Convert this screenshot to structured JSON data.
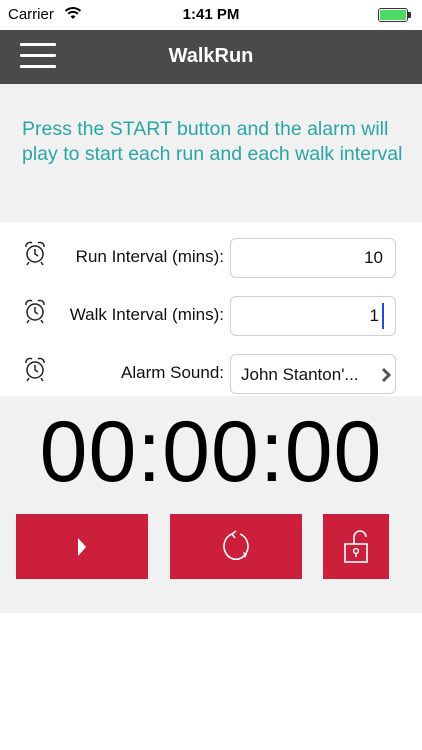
{
  "status_bar": {
    "carrier": "Carrier",
    "time": "1:41 PM",
    "battery_color": "#4cd964"
  },
  "nav": {
    "title": "WalkRun",
    "background": "#4a4a4a",
    "menu_icon": "hamburger-menu-icon"
  },
  "info": {
    "text": "Press the START button and the alarm will play to start each run and each walk interval",
    "color": "#2aa6a6"
  },
  "settings": {
    "run_interval": {
      "label": "Run Interval (mins):",
      "value": "10",
      "icon": "alarm-clock-icon"
    },
    "walk_interval": {
      "label": "Walk Interval (mins):",
      "value": "1",
      "icon": "alarm-clock-icon"
    },
    "alarm_sound": {
      "label": "Alarm Sound:",
      "value": "John Stanton'...",
      "icon": "alarm-clock-icon"
    }
  },
  "timer": {
    "display": "00:00:00"
  },
  "controls": {
    "accent": "#cc1f3b",
    "play_icon": "play-icon",
    "reset_icon": "reset-icon",
    "lock_icon": "unlock-icon"
  }
}
